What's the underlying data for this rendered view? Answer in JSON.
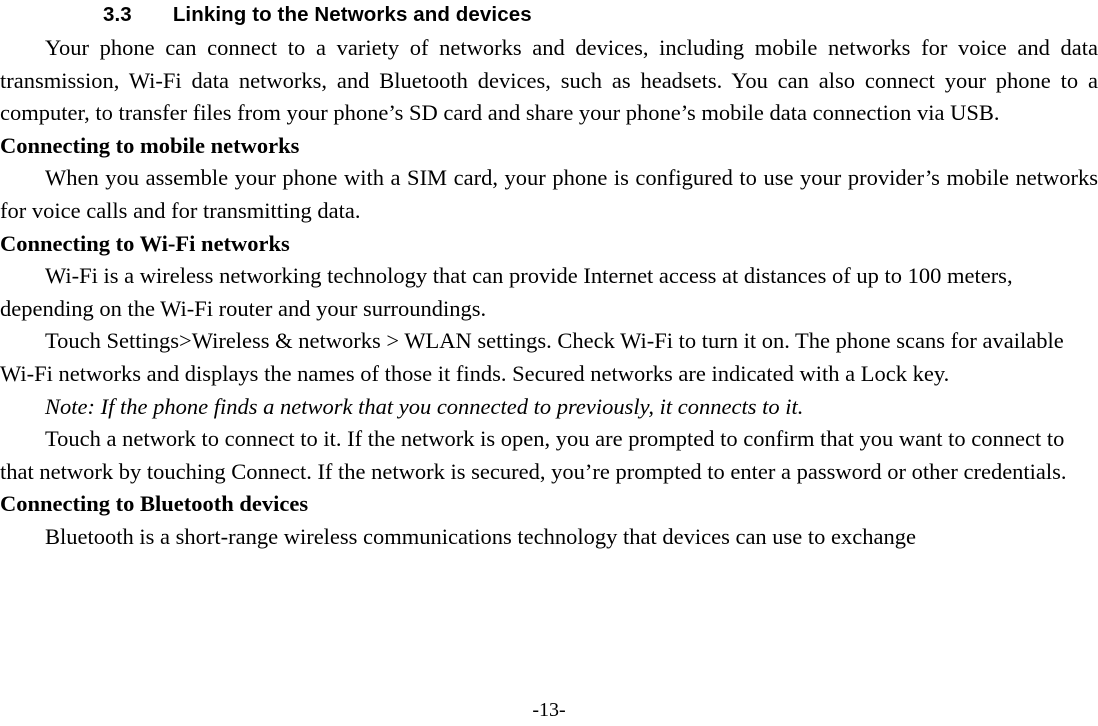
{
  "document": {
    "section": {
      "number": "3.3",
      "title": "Linking to the Networks and devices"
    },
    "intro_paragraph": "Your phone can connect to a variety of networks and devices, including mobile networks for voice and data transmission, Wi-Fi data networks, and Bluetooth devices, such as headsets. You can also connect your phone to a computer, to transfer files from your phone’s SD card and share your phone’s mobile data connection via USB.",
    "subsections": [
      {
        "heading": "Connecting to mobile networks",
        "paragraphs": [
          "When you assemble your phone with a SIM card, your phone is configured to use your provider’s mobile networks for voice calls and for transmitting data."
        ]
      },
      {
        "heading": "Connecting to Wi-Fi networks",
        "paragraphs": [
          "Wi-Fi is a wireless networking technology that can provide Internet access at distances of up to 100 meters, depending on the Wi-Fi router and your surroundings.",
          "Touch Settings>Wireless & networks > WLAN settings. Check Wi-Fi to turn it on. The phone scans for available Wi-Fi networks and displays the names of those it finds. Secured networks are indicated with a Lock key.",
          "Note: If the phone finds a network that you connected to previously, it connects to it.",
          "Touch a network to connect to it. If the network is open, you are prompted to confirm that you want to connect to that network by touching Connect. If the network is secured, you’re prompted to enter a password or other credentials."
        ]
      },
      {
        "heading": "Connecting to Bluetooth devices",
        "paragraphs": [
          "Bluetooth is a short-range wireless communications technology that devices can use to exchange"
        ]
      }
    ],
    "footer": {
      "page_number": "-13-"
    }
  }
}
